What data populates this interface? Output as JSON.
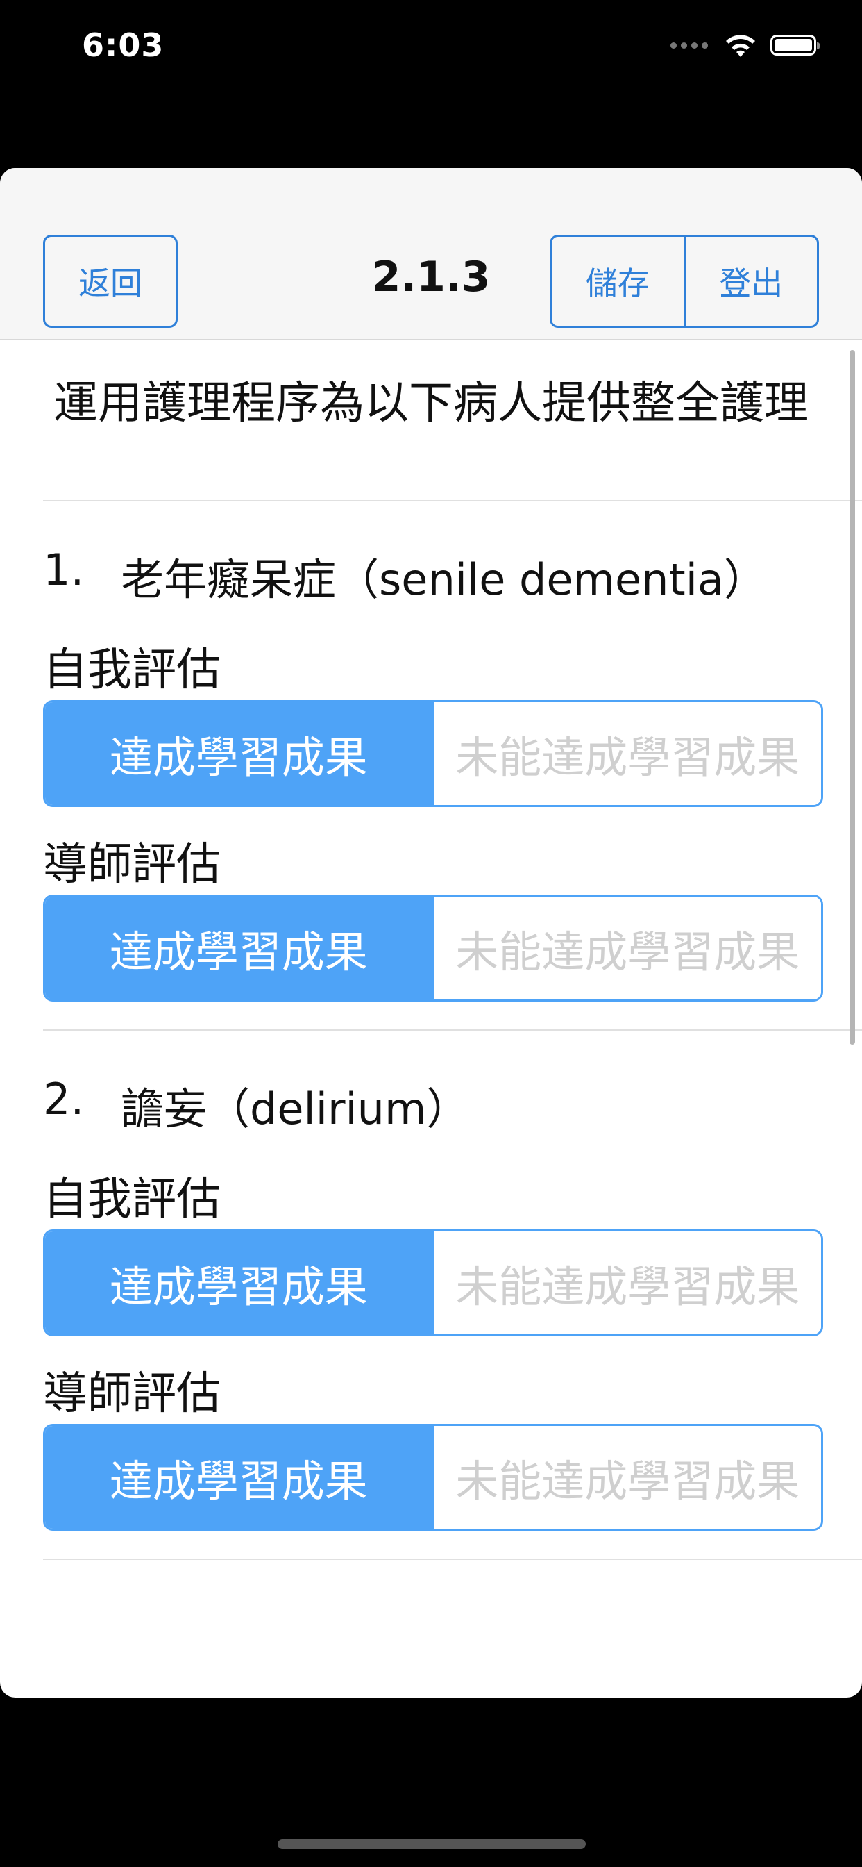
{
  "status_bar": {
    "time": "6:03"
  },
  "nav": {
    "back_label": "返回",
    "title": "2.1.3",
    "save_label": "儲存",
    "logout_label": "登出"
  },
  "heading": "運用護理程序為以下病人提供整全護理",
  "items": [
    {
      "number": "1.",
      "title": "老年癡呆症（senile dementia）",
      "self_eval_label": "自我評估",
      "tutor_eval_label": "導師評估",
      "achieved_label": "達成學習成果",
      "not_achieved_label": "未能達成學習成果"
    },
    {
      "number": "2.",
      "title": "譫妄（delirium）",
      "self_eval_label": "自我評估",
      "tutor_eval_label": "導師評估",
      "achieved_label": "達成學習成果",
      "not_achieved_label": "未能達成學習成果"
    }
  ],
  "colors": {
    "accent": "#2f80d9",
    "selected_fill": "#4ea3f7",
    "unselected_text": "#cfcfcf"
  }
}
